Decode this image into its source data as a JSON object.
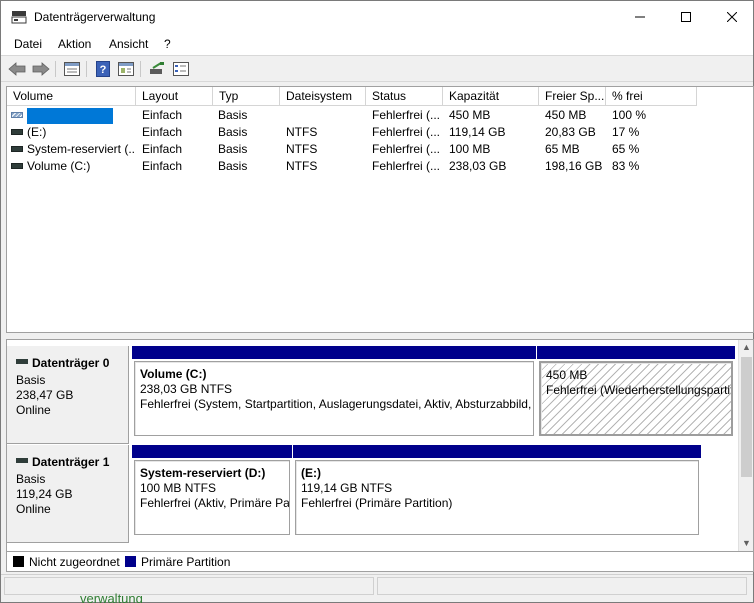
{
  "window": {
    "title": "Datenträgerverwaltung"
  },
  "menu": [
    "Datei",
    "Aktion",
    "Ansicht",
    "?"
  ],
  "toolbar": {
    "icons": [
      "back-arrow-icon",
      "forward-arrow-icon",
      "disk-list-icon",
      "help-icon",
      "properties-icon",
      "connect-icon",
      "settings-icon"
    ]
  },
  "volume_list": {
    "columns": [
      "Volume",
      "Layout",
      "Typ",
      "Dateisystem",
      "Status",
      "Kapazität",
      "Freier Sp...",
      "% frei"
    ],
    "rows": [
      {
        "volume": "",
        "layout": "Einfach",
        "typ": "Basis",
        "dateisystem": "",
        "status": "Fehlerfrei (...",
        "kapazitaet": "450 MB",
        "frei": "450 MB",
        "prozent": "100 %",
        "selected": true
      },
      {
        "volume": "(E:)",
        "layout": "Einfach",
        "typ": "Basis",
        "dateisystem": "NTFS",
        "status": "Fehlerfrei (...",
        "kapazitaet": "119,14 GB",
        "frei": "20,83 GB",
        "prozent": "17 %"
      },
      {
        "volume": "System-reserviert (...",
        "layout": "Einfach",
        "typ": "Basis",
        "dateisystem": "NTFS",
        "status": "Fehlerfrei (...",
        "kapazitaet": "100 MB",
        "frei": "65 MB",
        "prozent": "65 %"
      },
      {
        "volume": "Volume (C:)",
        "layout": "Einfach",
        "typ": "Basis",
        "dateisystem": "NTFS",
        "status": "Fehlerfrei (...",
        "kapazitaet": "238,03 GB",
        "frei": "198,16 GB",
        "prozent": "83 %"
      }
    ]
  },
  "disks": [
    {
      "name": "Datenträger 0",
      "type": "Basis",
      "size": "238,47 GB",
      "state": "Online",
      "partitions": [
        {
          "title": "Volume  (C:)",
          "size": "238,03 GB NTFS",
          "status": "Fehlerfrei (System, Startpartition, Auslagerungsdatei, Aktiv, Absturzabbild,"
        },
        {
          "title": "",
          "size": "450 MB",
          "status": "Fehlerfrei (Wiederherstellungspartit"
        }
      ]
    },
    {
      "name": "Datenträger 1",
      "type": "Basis",
      "size": "119,24 GB",
      "state": "Online",
      "partitions": [
        {
          "title": "System-reserviert  (D:)",
          "size": "100 MB NTFS",
          "status": "Fehlerfrei (Aktiv, Primäre Pa"
        },
        {
          "title": "(E:)",
          "size": "119,14 GB NTFS",
          "status": "Fehlerfrei (Primäre Partition)"
        }
      ]
    }
  ],
  "legend": [
    {
      "label": "Nicht zugeordnet",
      "color": "#000000"
    },
    {
      "label": "Primäre Partition",
      "color": "#00008b"
    }
  ],
  "background_peek": "verwaltung"
}
